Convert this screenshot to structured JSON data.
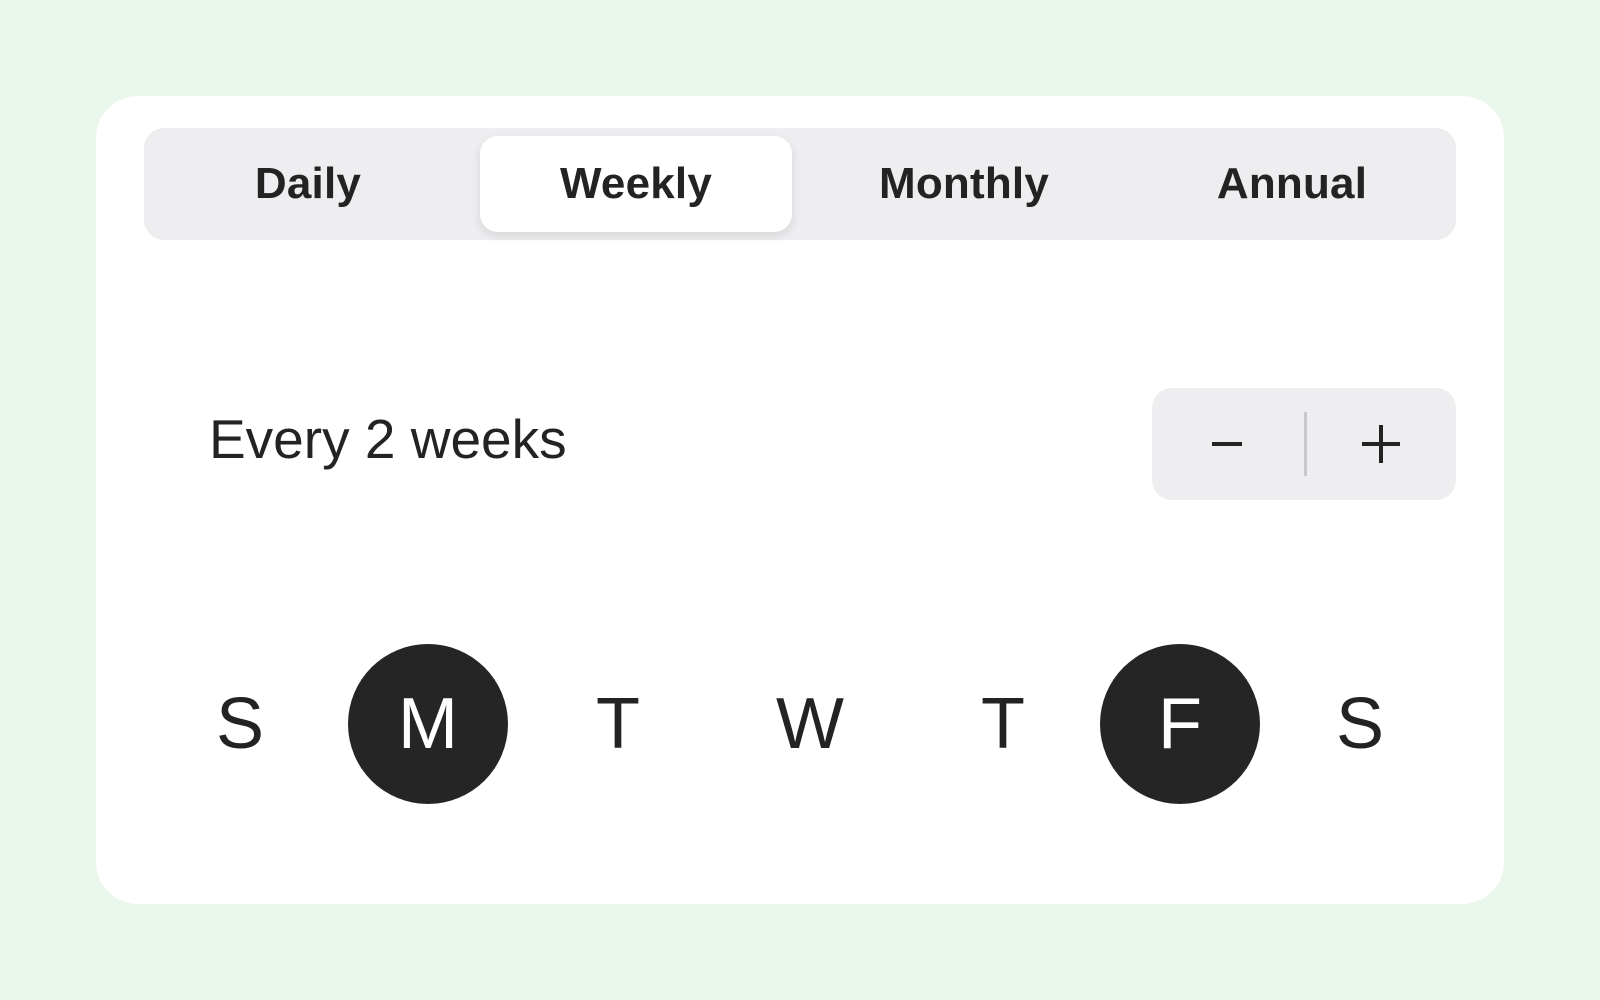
{
  "frequency_tabs": [
    {
      "label": "Daily",
      "active": false
    },
    {
      "label": "Weekly",
      "active": true
    },
    {
      "label": "Monthly",
      "active": false
    },
    {
      "label": "Annual",
      "active": false
    }
  ],
  "interval": {
    "label": "Every 2 weeks",
    "value": 2,
    "unit": "weeks"
  },
  "stepper": {
    "decrement_icon": "minus-icon",
    "increment_icon": "plus-icon"
  },
  "days": [
    {
      "label": "S",
      "name": "sunday",
      "selected": false
    },
    {
      "label": "M",
      "name": "monday",
      "selected": true
    },
    {
      "label": "T",
      "name": "tuesday",
      "selected": false
    },
    {
      "label": "W",
      "name": "wednesday",
      "selected": false
    },
    {
      "label": "T",
      "name": "thursday",
      "selected": false
    },
    {
      "label": "F",
      "name": "friday",
      "selected": true
    },
    {
      "label": "S",
      "name": "saturday",
      "selected": false
    }
  ],
  "colors": {
    "page_background": "#eaf7ec",
    "card_background": "#ffffff",
    "control_background": "#eeeef0",
    "selected_day": "#252525",
    "text": "#232323"
  }
}
